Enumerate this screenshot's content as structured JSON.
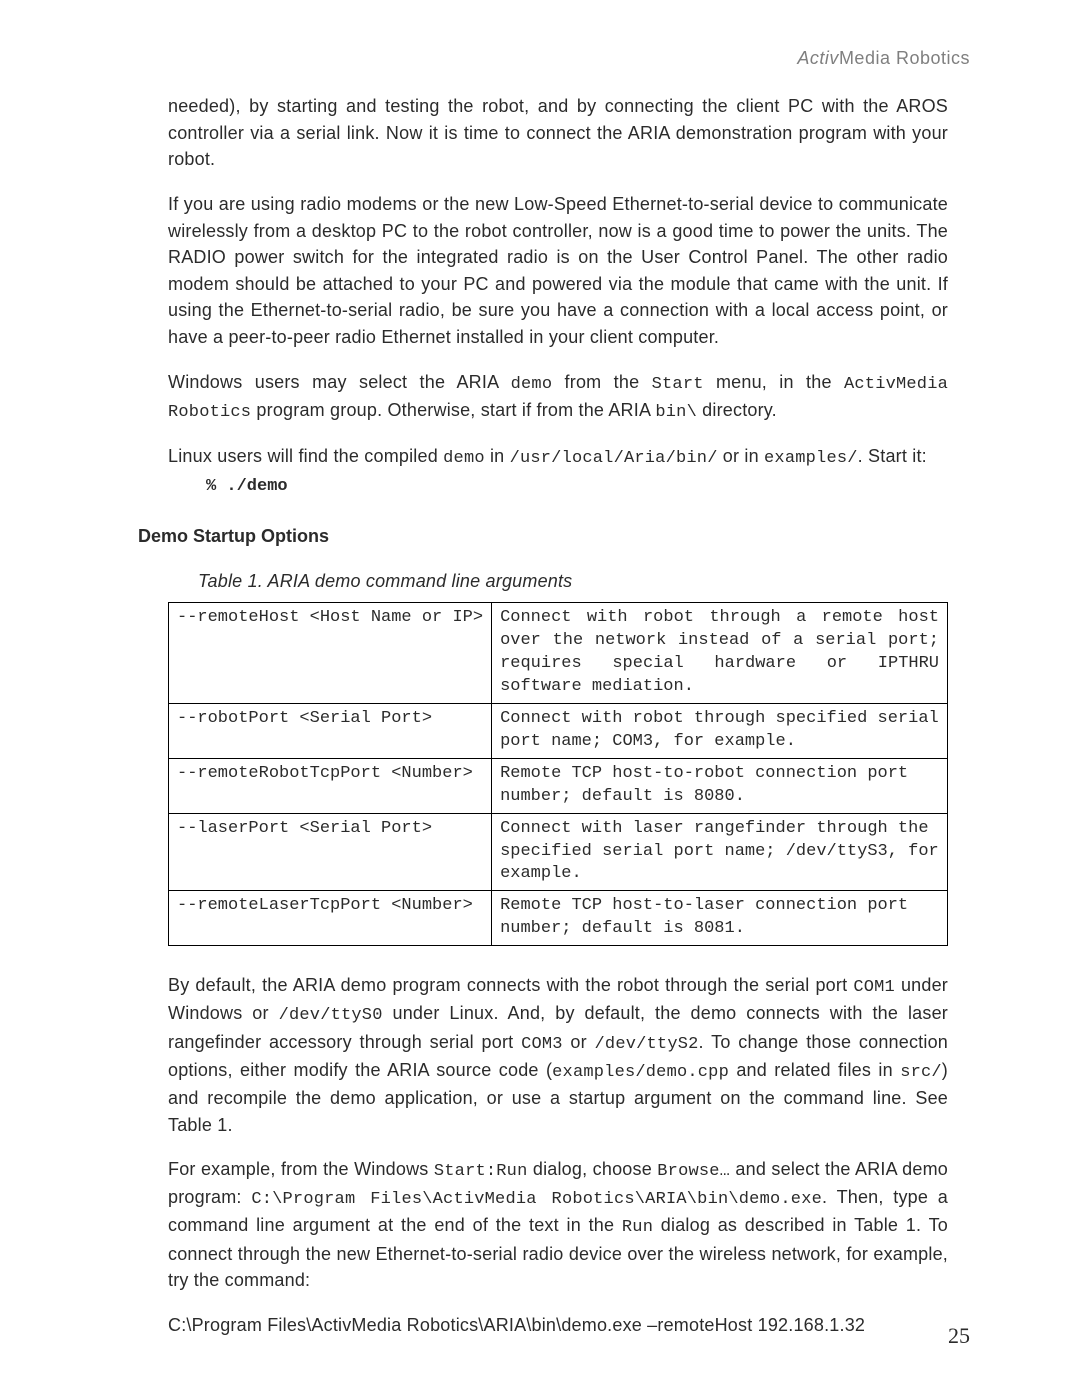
{
  "header": {
    "brand_italic": "Activ",
    "brand_rest": "Media Robotics"
  },
  "p1": {
    "t1": "needed), by starting and testing the robot, and by connecting the client PC with the AROS controller via a serial link.  Now it is time to connect the ARIA demonstration program with your robot."
  },
  "p2": {
    "t1": "If you are using radio modems or the new Low-Speed Ethernet-to-serial device to communicate wirelessly from a desktop PC to the robot controller, now is a good time to power the units.  The RADIO power switch for the integrated radio is on the User Control Panel.  The other radio modem should be attached to your PC and powered via the module that came with the unit.  If using the Ethernet-to-serial radio, be sure you have a connection with a local access point, or have a peer-to-peer radio Ethernet installed in your client computer."
  },
  "p3": {
    "t1": "Windows users may select the ARIA ",
    "m1": "demo",
    "t2": " from the ",
    "m2": "Start",
    "t3": " menu, in the ",
    "m3": "ActivMedia Robotics",
    "t4": " program group.  Otherwise, start if from the ARIA ",
    "m4": "bin\\",
    "t5": " directory."
  },
  "p4": {
    "t1": "Linux users will find the compiled ",
    "m1": "demo",
    "t2": " in ",
    "m2": "/usr/local/Aria/bin/",
    "t3": " or in ",
    "m3": "examples/",
    "t4": ".  Start it:"
  },
  "cmd1": "% ./demo",
  "section_heading": "Demo Startup Options",
  "table_caption": "Table 1. ARIA demo command line arguments",
  "rows": [
    {
      "opt": "--remoteHost <Host Name or IP>",
      "desc": "Connect with robot through a remote host over the network instead of a serial port; requires special hardware or IPTHRU software mediation.",
      "justify": true
    },
    {
      "opt": "--robotPort <Serial Port>",
      "desc": "Connect with robot through specified serial port name; COM3, for example.",
      "justify": false
    },
    {
      "opt": "--remoteRobotTcpPort <Number>",
      "desc": "Remote TCP host-to-robot connection port number; default is 8080.",
      "justify": false
    },
    {
      "opt": "--laserPort <Serial Port>",
      "desc": "Connect with laser rangefinder through the specified serial port name; /dev/ttyS3, for example.",
      "justify": false
    },
    {
      "opt": "--remoteLaserTcpPort <Number>",
      "desc": "Remote TCP host-to-laser connection port number; default is 8081.",
      "justify": false
    }
  ],
  "p5": {
    "t1": "By default, the ARIA demo program connects with the robot through the serial port ",
    "m1": "COM1",
    "t2": " under Windows or ",
    "m2": "/dev/ttyS0",
    "t3": " under Linux.  And, by default, the demo connects with the laser rangefinder accessory through serial port ",
    "m3": "COM3",
    "t4": " or ",
    "m4": "/dev/ttyS2",
    "t5": ".  To change those connection options, either modify the ARIA source code (",
    "m5": "examples/demo.cpp",
    "t6": " and related files in ",
    "m6": "src/",
    "t7": ") and recompile the demo application, or use a startup argument on the command line.  See Table 1."
  },
  "p6": {
    "t1": "For example, from the Windows ",
    "m1": "Start:Run",
    "t2": " dialog, choose ",
    "m2": "Browse…",
    "t3": " and select the ARIA demo program: ",
    "m3": "C:\\Program Files\\ActivMedia Robotics\\ARIA\\bin\\demo.exe",
    "t4": ".  Then, type a command line argument at the end of the text in the ",
    "m4": "Run",
    "t5": " dialog as described in Table 1.  To connect through the new Ethernet-to-serial radio device over the wireless network, for example, try the command:"
  },
  "p7": {
    "t1": "C:\\Program Files\\ActivMedia Robotics\\ARIA\\bin\\demo.exe –remoteHost 192.168.1.32"
  },
  "page_number": "25"
}
